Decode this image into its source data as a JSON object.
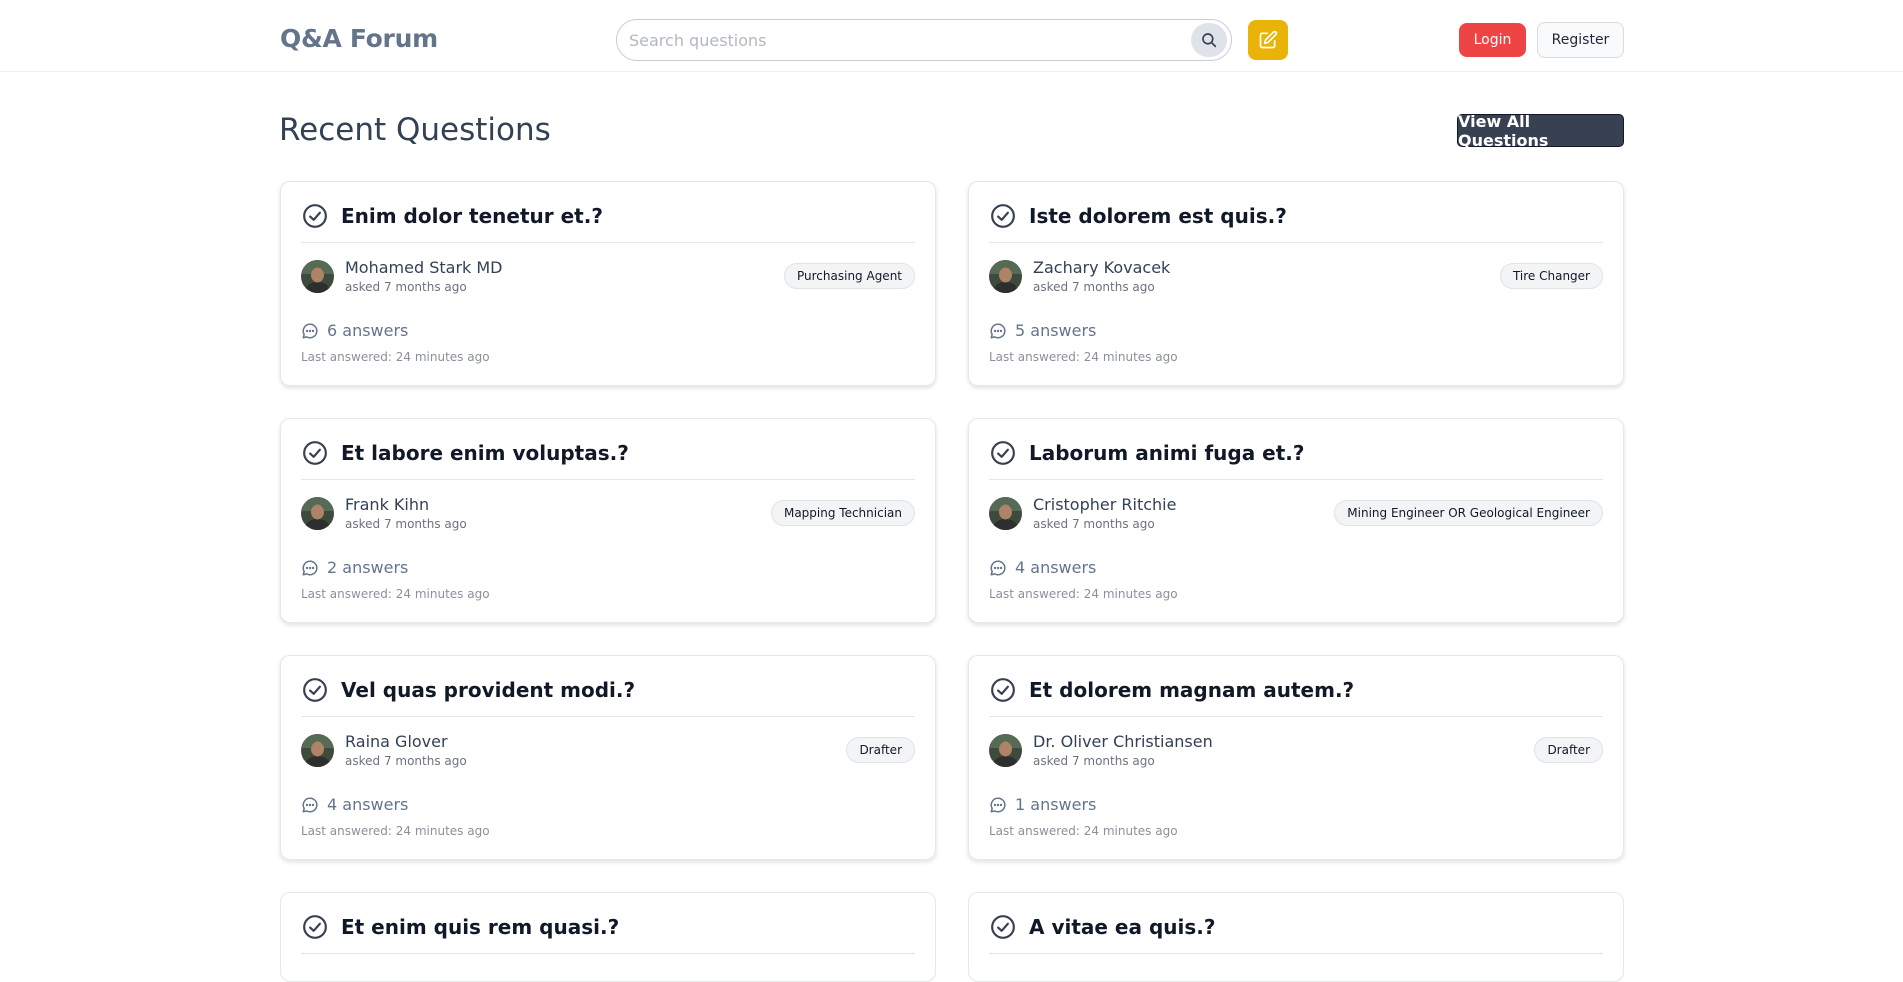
{
  "header": {
    "brand": "Q&A Forum",
    "search_placeholder": "Search questions",
    "login_label": "Login",
    "register_label": "Register"
  },
  "main": {
    "title": "Recent Questions",
    "view_all_label": "View All Questions"
  },
  "questions": [
    {
      "title": "Enim dolor tenetur et.?",
      "author": "Mohamed Stark MD",
      "asked": "asked 7 months ago",
      "tag": "Purchasing Agent",
      "answers": "6 answers",
      "last_answered": "Last answered: 24 minutes ago"
    },
    {
      "title": "Iste dolorem est quis.?",
      "author": "Zachary Kovacek",
      "asked": "asked 7 months ago",
      "tag": "Tire Changer",
      "answers": "5 answers",
      "last_answered": "Last answered: 24 minutes ago"
    },
    {
      "title": "Et labore enim voluptas.?",
      "author": "Frank Kihn",
      "asked": "asked 7 months ago",
      "tag": "Mapping Technician",
      "answers": "2 answers",
      "last_answered": "Last answered: 24 minutes ago"
    },
    {
      "title": "Laborum animi fuga et.?",
      "author": "Cristopher Ritchie",
      "asked": "asked 7 months ago",
      "tag": "Mining Engineer OR Geological Engineer",
      "answers": "4 answers",
      "last_answered": "Last answered: 24 minutes ago"
    },
    {
      "title": "Vel quas provident modi.?",
      "author": "Raina Glover",
      "asked": "asked 7 months ago",
      "tag": "Drafter",
      "answers": "4 answers",
      "last_answered": "Last answered: 24 minutes ago"
    },
    {
      "title": "Et dolorem magnam autem.?",
      "author": "Dr. Oliver Christiansen",
      "asked": "asked 7 months ago",
      "tag": "Drafter",
      "answers": "1 answers",
      "last_answered": "Last answered: 24 minutes ago"
    },
    {
      "title": "Et enim quis rem quasi.?"
    },
    {
      "title": "A vitae ea quis.?"
    }
  ],
  "colors": {
    "accent_red": "#ef4444",
    "accent_yellow": "#eab308",
    "dark_button": "#374151"
  },
  "icons": {
    "search": "search-icon",
    "ask": "edit-icon",
    "question": "check-circle-icon",
    "answers": "chat-bubble-icon"
  }
}
